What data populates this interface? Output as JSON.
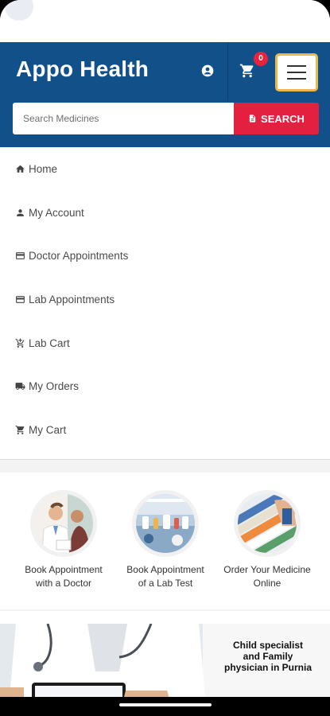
{
  "app": {
    "title": "Appo Health"
  },
  "header": {
    "cart_count": "0",
    "search": {
      "placeholder": "Search Medicines",
      "button_label": "SEARCH"
    }
  },
  "menu": {
    "items": [
      {
        "label": "Home",
        "icon": "home-icon"
      },
      {
        "label": "My Account",
        "icon": "person-icon"
      },
      {
        "label": "Doctor Appointments",
        "icon": "card-icon"
      },
      {
        "label": "Lab Appointments",
        "icon": "card-icon"
      },
      {
        "label": "Lab Cart",
        "icon": "cart-add-icon"
      },
      {
        "label": "My Orders",
        "icon": "truck-icon"
      },
      {
        "label": "My Cart",
        "icon": "cart-icon"
      }
    ]
  },
  "services": [
    {
      "label_line1": "Book Appointment",
      "label_line2": "with a Doctor",
      "icon": "doctor-photo"
    },
    {
      "label_line1": "Book Appointment",
      "label_line2": "of a Lab Test",
      "icon": "lab-photo"
    },
    {
      "label_line1": "Order Your Medicine",
      "label_line2": "Online",
      "icon": "pharmacy-photo"
    }
  ],
  "banner": {
    "line1": "Child specialist",
    "line2": "and Family",
    "line3": "physician in Purnia"
  },
  "colors": {
    "header_blue": "#12508a",
    "search_red": "#e3203f",
    "badge_red": "#e8233e",
    "menu_button_border": "#e9b949"
  }
}
